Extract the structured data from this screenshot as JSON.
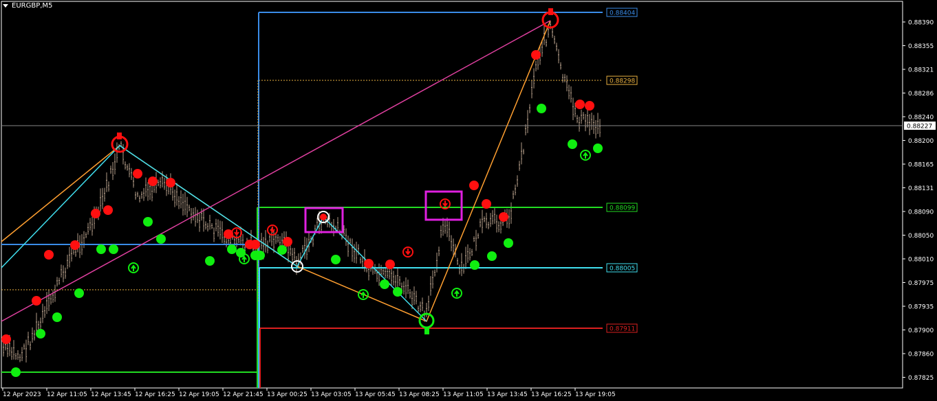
{
  "chart": {
    "symbol": "EURGBP,M5",
    "background": "#000000",
    "axis_color": "#ffffff",
    "candle_color": "#b09a86"
  },
  "price_axis": {
    "ticks": [
      "0.88390",
      "0.88355",
      "0.88321",
      "0.88286",
      "0.88240",
      "0.88200",
      "0.88165",
      "0.88131",
      "0.88090",
      "0.88050",
      "0.88010",
      "0.87975",
      "0.87935",
      "0.87900",
      "0.87860",
      "0.87825"
    ],
    "current_price": "0.88227"
  },
  "time_axis": {
    "labels": [
      "12 Apr 2023",
      "12 Apr 11:05",
      "12 Apr 13:45",
      "12 Apr 16:25",
      "12 Apr 19:05",
      "12 Apr 21:45",
      "13 Apr 00:25",
      "13 Apr 03:05",
      "13 Apr 05:45",
      "13 Apr 08:25",
      "13 Apr 11:05",
      "13 Apr 13:45",
      "13 Apr 16:25",
      "13 Apr 19:05"
    ]
  },
  "levels": [
    {
      "name": "top-level",
      "price": "0.88404",
      "color": "#3a8ce8"
    },
    {
      "name": "mid-upper-level",
      "price": "0.88298",
      "color": "#e8b040"
    },
    {
      "name": "green-level",
      "price": "0.88099",
      "color": "#22dd22"
    },
    {
      "name": "cyan-level",
      "price": "0.88005",
      "color": "#40e0f0"
    },
    {
      "name": "red-level",
      "price": "0.87911",
      "color": "#dd2020"
    }
  ],
  "colors": {
    "zigzag_orange": "#ff9f30",
    "zigzag_cyan": "#40e0f0",
    "trend_magenta": "#e040a0",
    "sell_dot": "#ff1010",
    "buy_dot": "#10ee10",
    "box": "#e020e0"
  }
}
